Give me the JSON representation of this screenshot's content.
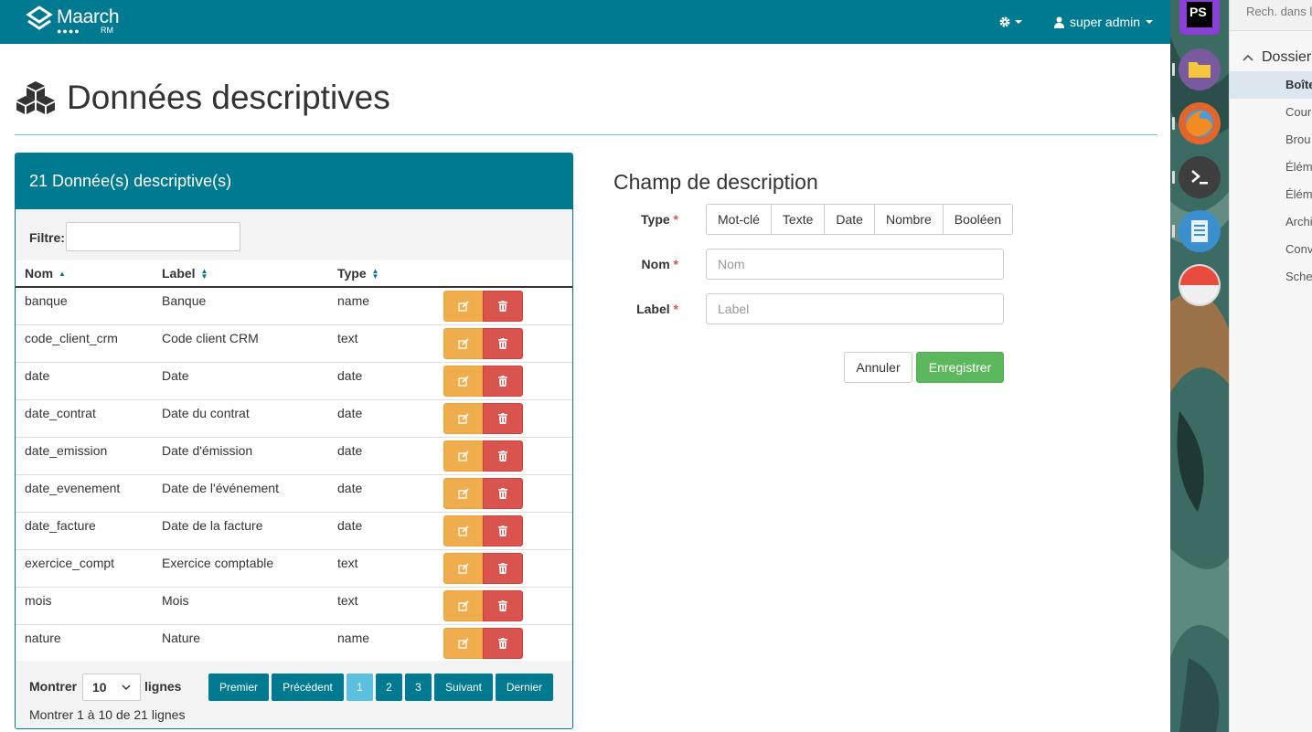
{
  "app": {
    "brand": "Maarch",
    "brand_sub": "RM",
    "user_menu_label": "super admin",
    "page_title": "Données descriptives"
  },
  "list_panel": {
    "heading": "21 Donnée(s) descriptive(s)",
    "filter_label": "Filtre:",
    "filter_value": "",
    "columns": [
      "Nom",
      "Label",
      "Type"
    ],
    "rows": [
      {
        "nom": "banque",
        "label": "Banque",
        "type": "name"
      },
      {
        "nom": "code_client_crm",
        "label": "Code client CRM",
        "type": "text"
      },
      {
        "nom": "date",
        "label": "Date",
        "type": "date"
      },
      {
        "nom": "date_contrat",
        "label": "Date du contrat",
        "type": "date"
      },
      {
        "nom": "date_emission",
        "label": "Date d'émission",
        "type": "date"
      },
      {
        "nom": "date_evenement",
        "label": "Date de l'événement",
        "type": "date"
      },
      {
        "nom": "date_facture",
        "label": "Date de la facture",
        "type": "date"
      },
      {
        "nom": "exercice_compt",
        "label": "Exercice comptable",
        "type": "text"
      },
      {
        "nom": "mois",
        "label": "Mois",
        "type": "text"
      },
      {
        "nom": "nature",
        "label": "Nature",
        "type": "name"
      }
    ],
    "show_label": "Montrer",
    "page_size": "10",
    "rows_label": "lignes",
    "info": "Montrer 1 à 10 de 21 lignes",
    "pager": {
      "first": "Premier",
      "prev": "Précédent",
      "pages": [
        "1",
        "2",
        "3"
      ],
      "active_page": "1",
      "next": "Suivant",
      "last": "Dernier"
    }
  },
  "form": {
    "title": "Champ de description",
    "type_label": "Type",
    "type_options": [
      "Mot-clé",
      "Texte",
      "Date",
      "Nombre",
      "Booléen"
    ],
    "name_label": "Nom",
    "name_placeholder": "Nom",
    "label_label": "Label",
    "label_placeholder": "Label",
    "required_mark": "*",
    "cancel": "Annuler",
    "save": "Enregistrer"
  },
  "dock": {
    "phpstorm_badge": "PS"
  },
  "file_manager": {
    "search_text": "Rech. dans le",
    "section": "Dossiers",
    "items": [
      "Boîte",
      "Cour",
      "Brou",
      "Éléme",
      "Éléme",
      "Archi",
      "Conv",
      "Sche"
    ],
    "selected_index": 0
  },
  "colors": {
    "primary": "#007a91",
    "warning": "#f0ad4e",
    "danger": "#d9534f",
    "success": "#5cb85c",
    "info": "#5bc0de"
  }
}
